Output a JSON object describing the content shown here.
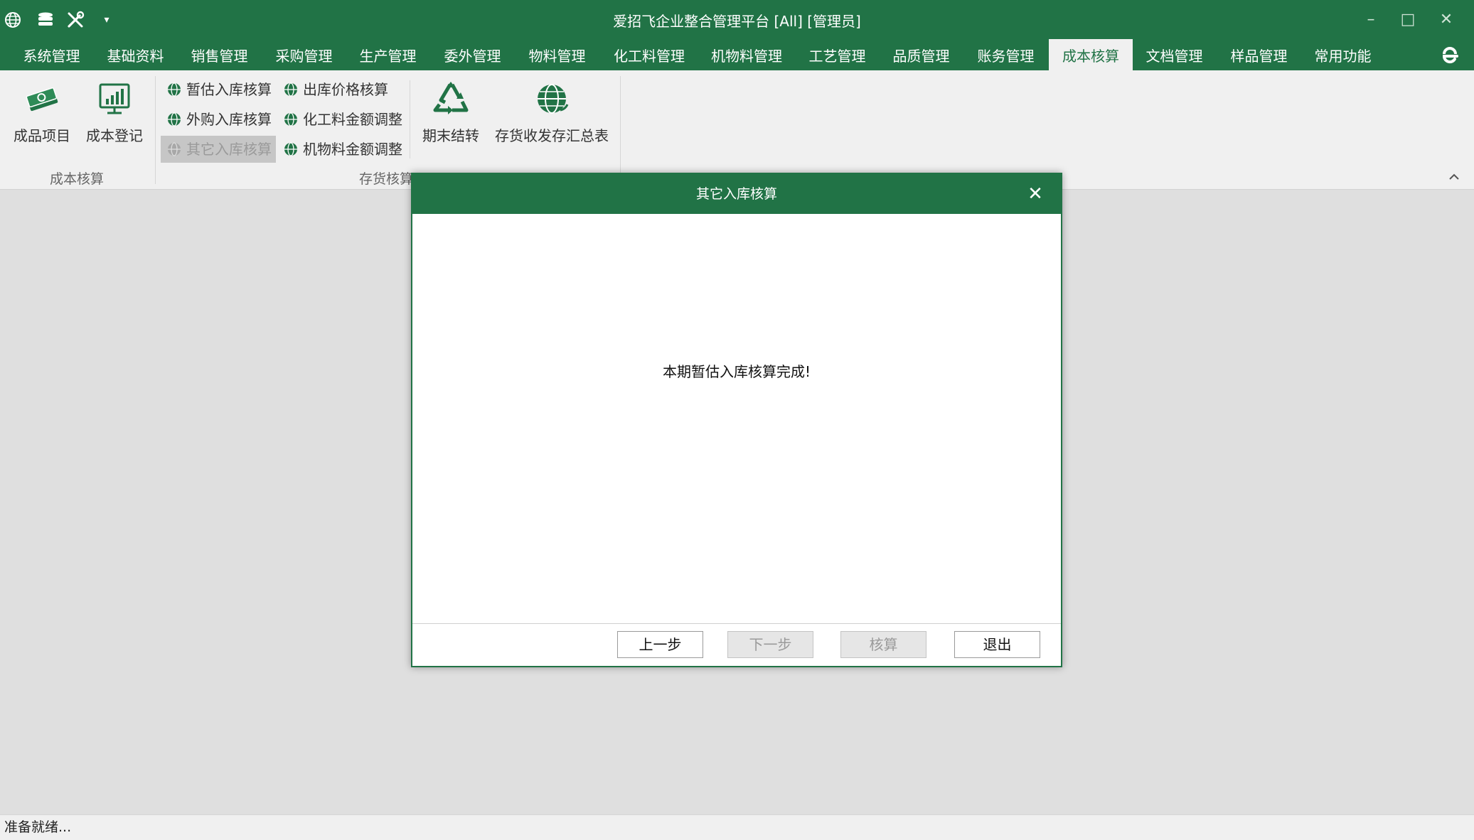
{
  "window": {
    "title": "爱招飞企业整合管理平台 [All] [管理员]",
    "minimize": "–",
    "maximize": "□",
    "close": "✕",
    "quick_access_more": "▾"
  },
  "menu_tabs": [
    {
      "label": "系统管理"
    },
    {
      "label": "基础资料"
    },
    {
      "label": "销售管理"
    },
    {
      "label": "采购管理"
    },
    {
      "label": "生产管理"
    },
    {
      "label": "委外管理"
    },
    {
      "label": "物料管理"
    },
    {
      "label": "化工料管理"
    },
    {
      "label": "机物料管理"
    },
    {
      "label": "工艺管理"
    },
    {
      "label": "品质管理"
    },
    {
      "label": "账务管理"
    },
    {
      "label": "成本核算",
      "active": true
    },
    {
      "label": "文档管理"
    },
    {
      "label": "样品管理"
    },
    {
      "label": "常用功能"
    }
  ],
  "ribbon": {
    "group1": {
      "label": "成本核算",
      "buttons": [
        {
          "label": "成品项目",
          "icon": "money-icon"
        },
        {
          "label": "成本登记",
          "icon": "chart-board-icon"
        }
      ]
    },
    "group2": {
      "label": "存货核算",
      "small_buttons": [
        {
          "label": "暂估入库核算",
          "icon": "globe-icon"
        },
        {
          "label": "外购入库核算",
          "icon": "globe-icon"
        },
        {
          "label": "其它入库核算",
          "icon": "globe-icon",
          "disabled": true
        },
        {
          "label": "出库价格核算",
          "icon": "globe-icon"
        },
        {
          "label": "化工料金额调整",
          "icon": "globe-icon"
        },
        {
          "label": "机物料金额调整",
          "icon": "globe-icon"
        }
      ],
      "big_buttons": [
        {
          "label": "期末结转",
          "icon": "recycle-icon"
        },
        {
          "label": "存货收发存汇总表",
          "icon": "globe-refresh-icon"
        }
      ]
    }
  },
  "dialog": {
    "title": "其它入库核算",
    "close": "✕",
    "message": "本期暂估入库核算完成!",
    "buttons": {
      "prev": "上一步",
      "next": "下一步",
      "calc": "核算",
      "exit": "退出"
    }
  },
  "status": {
    "text": "准备就绪..."
  },
  "colors": {
    "brand": "#217346",
    "ribbon_bg": "#f0f0f0",
    "workspace_bg": "#dfdfdf"
  }
}
